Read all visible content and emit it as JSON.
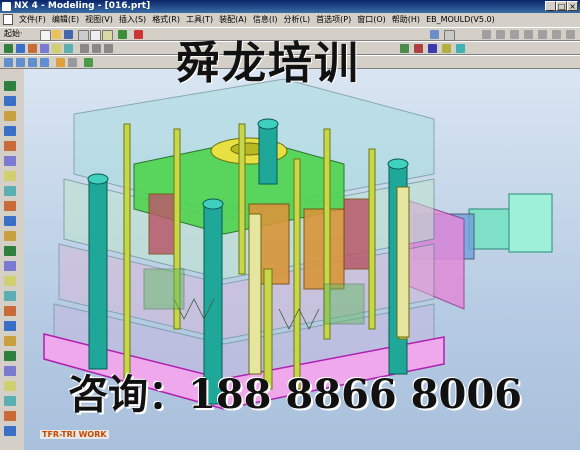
{
  "window": {
    "title": "NX 4 - Modeling - [016.prt]",
    "controls": [
      "_",
      "□",
      "×"
    ]
  },
  "menu": [
    "文件(F)",
    "编辑(E)",
    "视图(V)",
    "插入(S)",
    "格式(R)",
    "工具(T)",
    "装配(A)",
    "信息(I)",
    "分析(L)",
    "首选项(P)",
    "窗口(O)",
    "帮助(H)",
    "EB_MOULD(V5.0)"
  ],
  "toolbar": {
    "start_label": "起始·"
  },
  "watermark": {
    "brand": "舜龙培训",
    "contact": "咨询：188 8866 8006"
  },
  "logo": "TFR-TRI WORK",
  "colors": {
    "title_bar": "#0a246a",
    "plate_clear": "#9ed3d8",
    "plate_green": "#4fd44f",
    "plate_pink": "#e28ad8",
    "cylinder_teal": "#1fa89a",
    "pin_yellow": "#c8d64a",
    "slider_orange": "#d9953a",
    "cylinder_side": "#7fe0c8"
  }
}
